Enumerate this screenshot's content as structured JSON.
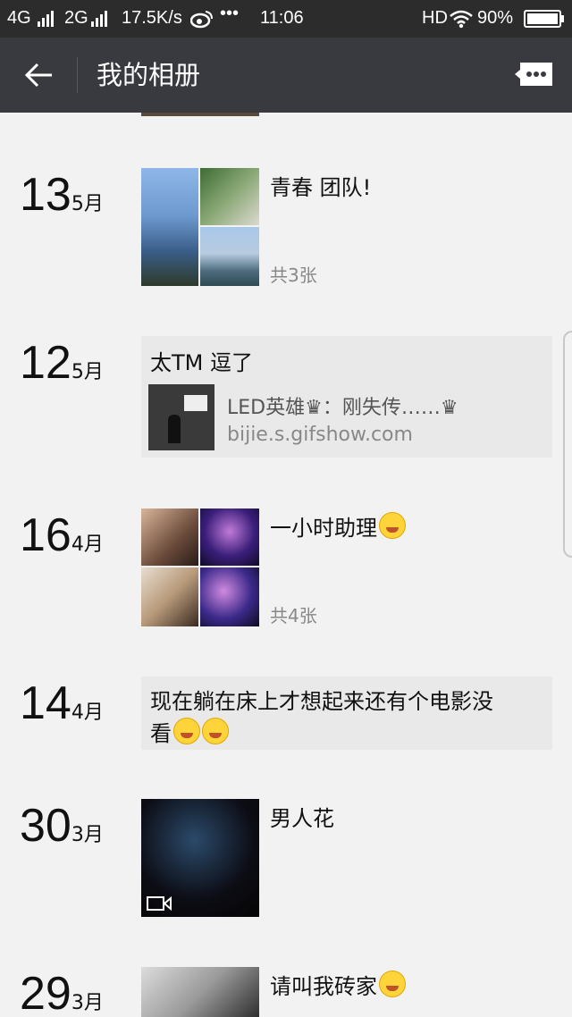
{
  "status_bar": {
    "network_1": "4G",
    "network_2": "2G",
    "speed": "17.5K/s",
    "more": "•••",
    "time": "11:06",
    "hd": "HD",
    "battery": "90%",
    "icons": [
      "signal-icon",
      "weibo-icon",
      "wifi-icon",
      "battery-icon"
    ]
  },
  "nav": {
    "title": "我的相册",
    "back_icon": "arrow-left-icon",
    "more_icon": "message-bubble-icon"
  },
  "posts": [
    {
      "day": "13",
      "month": "5月",
      "caption": "青春  团队!",
      "count": "共3张",
      "type": "photos-3"
    },
    {
      "day": "12",
      "month": "5月",
      "caption": "太TM 逗了",
      "type": "share",
      "link_title": "LED英雄♛：刚失传……♛",
      "link_url": "bijie.s.gifshow.com"
    },
    {
      "day": "16",
      "month": "4月",
      "caption": "一小时助理",
      "count": "共4张",
      "type": "photos-4"
    },
    {
      "day": "14",
      "month": "4月",
      "caption_line1": "现在躺在床上才想起来还有个电影没",
      "caption_line2": "看",
      "type": "text"
    },
    {
      "day": "30",
      "month": "3月",
      "caption": "男人花",
      "type": "video"
    },
    {
      "day": "29",
      "month": "3月",
      "caption": "请叫我砖家",
      "type": "photo"
    }
  ],
  "colors": {
    "status_bar": "#2c2c2c",
    "nav_bar": "#393a3f",
    "page_bg": "#f2f2f2",
    "share_bg": "#e9e9e9"
  }
}
